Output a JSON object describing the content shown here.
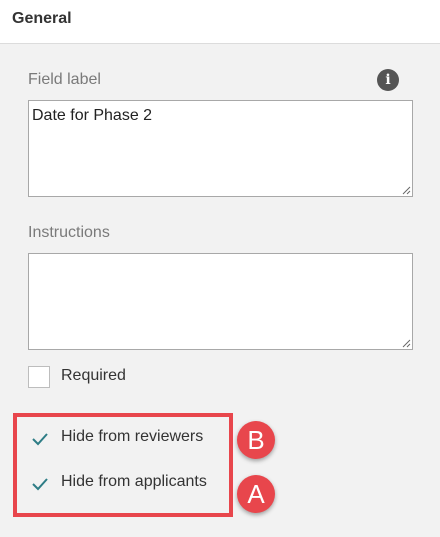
{
  "header": {
    "title": "General"
  },
  "form": {
    "field_label": {
      "label": "Field label",
      "value": "Date for Phase 2",
      "info_icon": "info-icon"
    },
    "instructions": {
      "label": "Instructions",
      "value": ""
    },
    "checkboxes": [
      {
        "label": "Required",
        "checked": false
      },
      {
        "label": "Hide from reviewers",
        "checked": true
      },
      {
        "label": "Hide from applicants",
        "checked": true
      }
    ]
  },
  "annotations": {
    "highlight_color": "#e8464c",
    "markers": [
      {
        "letter": "B",
        "target": "Hide from reviewers"
      },
      {
        "letter": "A",
        "target": "Hide from applicants"
      }
    ]
  },
  "colors": {
    "check": "#2e7d86",
    "background": "#f2f2f2",
    "header_bg": "#ffffff"
  }
}
